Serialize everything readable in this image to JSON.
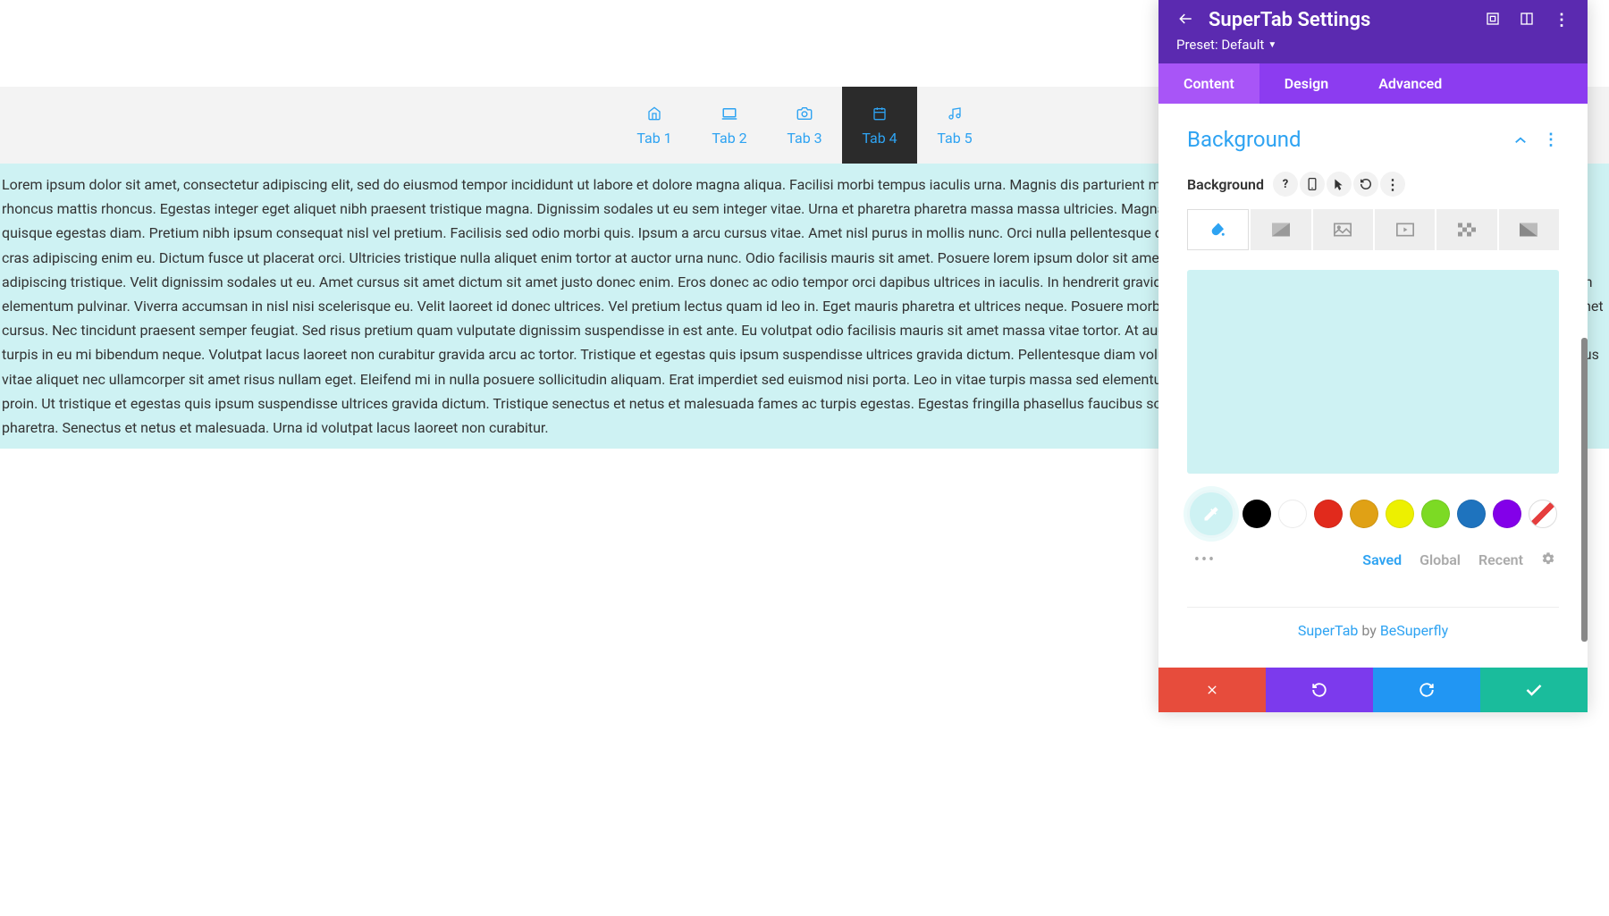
{
  "tabs": [
    {
      "label": "Tab 1",
      "icon": "home"
    },
    {
      "label": "Tab 2",
      "icon": "laptop"
    },
    {
      "label": "Tab 3",
      "icon": "camera"
    },
    {
      "label": "Tab 4",
      "icon": "calendar",
      "active": true
    },
    {
      "label": "Tab 5",
      "icon": "music"
    }
  ],
  "content_text": "Lorem ipsum dolor sit amet, consectetur adipiscing elit, sed do eiusmod tempor incididunt ut labore et dolore magna aliqua. Facilisi morbi tempus iaculis urna. Magnis dis parturient montes nascetur ridiculus mus mauris vitae ultricies. Sagittis nisl rhoncus mattis rhoncus. Egestas integer eget aliquet nibh praesent tristique magna. Dignissim sodales ut eu sem integer vitae. Urna et pharetra pharetra massa massa ultricies. Magna fermentum iaculis eu non diam. Bibendum neque egestas congue quisque egestas diam. Pretium nibh ipsum consequat nisl vel pretium. Facilisis sed odio morbi quis. Ipsum a arcu cursus vitae. Amet nisl purus in mollis nunc. Orci nulla pellentesque dignissim enim sit. Ultricies lacus sed turpis tincidunt id. Amet tellus cras adipiscing enim eu. Dictum fusce ut placerat orci. Ultricies tristique nulla aliquet enim tortor at auctor urna nunc. Odio facilisis mauris sit amet. Posuere lorem ipsum dolor sit amet consectetur adipiscing elit. Aenean sed adipiscing diam donec adipiscing tristique. Velit dignissim sodales ut eu. Amet cursus sit amet dictum sit amet justo donec enim. Eros donec ac odio tempor orci dapibus ultrices in iaculis. In hendrerit gravida rutrum quisque non tellus orci ac. Quam quisque id diam vel quam elementum pulvinar. Viverra accumsan in nisl nisi scelerisque eu. Velit laoreet id donec ultrices. Vel pretium lectus quam id leo in. Eget mauris pharetra et ultrices neque. Posuere morbi leo urna molestie at. Semper viverra nam libero justo laoreet sit amet cursus. Nec tincidunt praesent semper feugiat. Sed risus pretium quam vulputate dignissim suspendisse in est ante. Eu volutpat odio facilisis mauris sit amet massa vitae tortor. At auctor urna nunc id cursus metus aliquam eleifend. Enim sed faucibus turpis in eu mi bibendum neque. Volutpat lacus laoreet non curabitur gravida arcu ac tortor. Tristique et egestas quis ipsum suspendisse ultrices gravida dictum. Pellentesque diam volutpat commodo sed. Pretium fusce id velit ut tortor pretium. Faucibus vitae aliquet nec ullamcorper sit amet risus nullam eget. Eleifend mi in nulla posuere sollicitudin aliquam. Erat imperdiet sed euismod nisi porta. Leo in vitae turpis massa sed elementum tempus. Tellus in metus vulputate eu scelerisque felis imperdiet proin. Ut tristique et egestas quis ipsum suspendisse ultrices gravida dictum. Tristique senectus et netus et malesuada fames ac turpis egestas. Egestas fringilla phasellus faucibus scelerisque eleifend. Sit amet justo donec enim diam vulputate ut pharetra. Senectus et netus et malesuada. Urna id volutpat lacus laoreet non curabitur.",
  "panel": {
    "title": "SuperTab Settings",
    "preset_label": "Preset: Default",
    "tabs": {
      "content": "Content",
      "design": "Design",
      "advanced": "Advanced"
    },
    "section_title": "Background",
    "field_label": "Background",
    "swatch_tabs": {
      "saved": "Saved",
      "global": "Global",
      "recent": "Recent"
    },
    "colors": [
      "#000000",
      "#ffffff",
      "#e12a1c",
      "#e0a115",
      "#edf000",
      "#7CDA24",
      "#1e73be",
      "#8300e9"
    ],
    "preview_color": "#cef2f3",
    "credit": {
      "product": "SuperTab",
      "by": " by ",
      "author": "BeSuperfly"
    }
  }
}
